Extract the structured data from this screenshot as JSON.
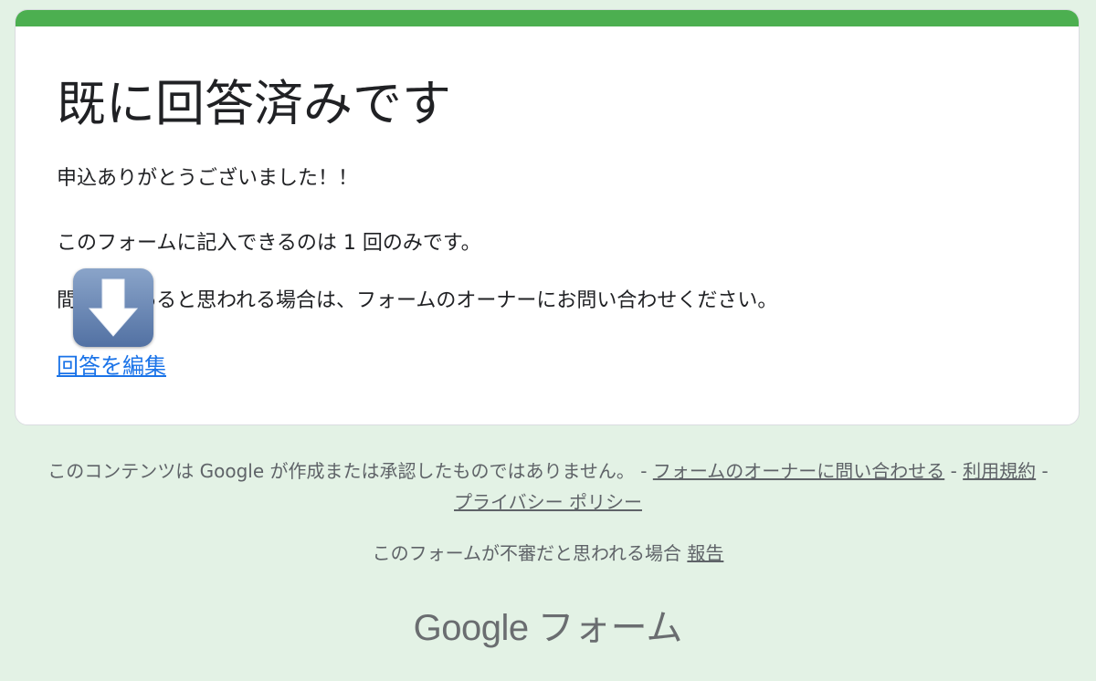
{
  "card": {
    "title": "既に回答済みです",
    "message_1": "申込ありがとうございました！！",
    "message_2": "このフォームに記入できるのは 1 回のみです。",
    "message_3": "間違いであると思われる場合は、フォームのオーナーにお問い合わせください。",
    "edit_link": "回答を編集",
    "accent_color": "#4caf50"
  },
  "overlay": {
    "icon": "down-arrow-icon"
  },
  "footer": {
    "disclaimer": "このコンテンツは Google が作成または承認したものではありません。 - ",
    "contact_owner_link": "フォームのオーナーに問い合わせる",
    "separator_1": " - ",
    "terms_link": "利用規約",
    "separator_2": " - ",
    "privacy_link": "プライバシー ポリシー",
    "report_text": "このフォームが不審だと思われる場合 ",
    "report_link": "報告"
  },
  "brand": {
    "google": "Google",
    "product": "フォーム"
  },
  "colors": {
    "background": "#e3f2e5",
    "link": "#1a73e8"
  }
}
